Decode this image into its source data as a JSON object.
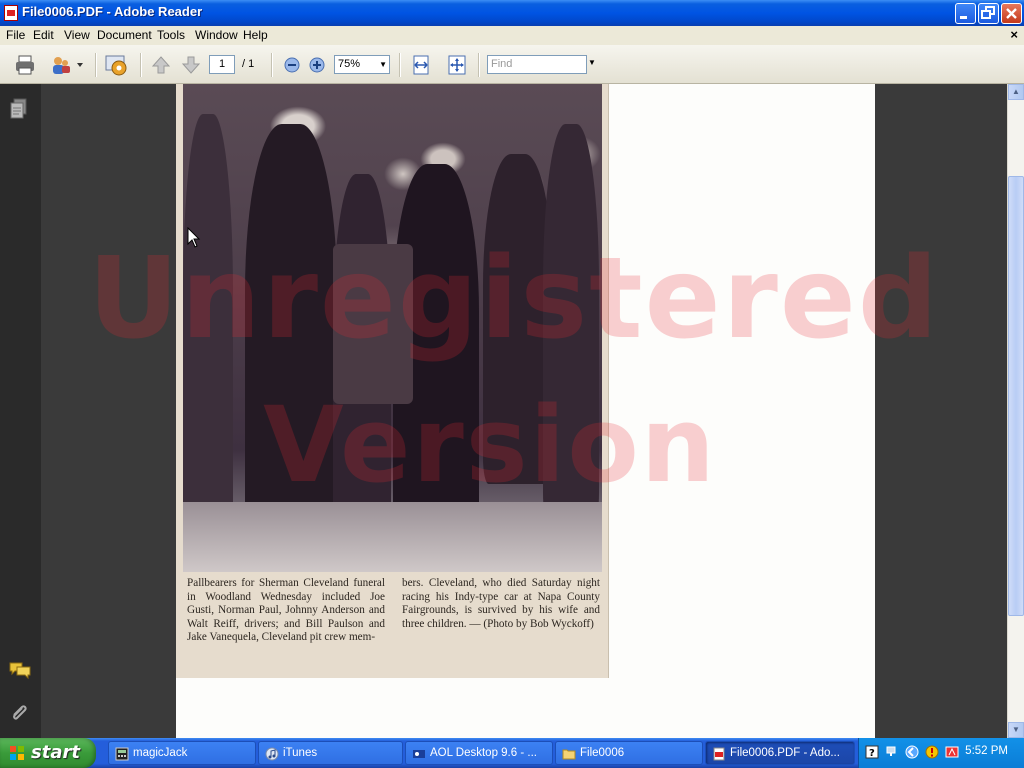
{
  "window": {
    "title": "File0006.PDF - Adobe Reader"
  },
  "menubar": {
    "items": [
      "File",
      "Edit",
      "View",
      "Document",
      "Tools",
      "Window",
      "Help"
    ],
    "close_glyph": "×"
  },
  "toolbar": {
    "current_page": "1",
    "total_pages": "/ 1",
    "zoom": "75%",
    "find_placeholder": "Find"
  },
  "document": {
    "caption_left": "Pallbearers for Sherman Cleveland funeral in Woodland Wednesday included Joe Gusti, Norman Paul, Johnny Anderson and Walt Reiff, drivers; and Bill Paulson and Jake Vanequela, Cleveland pit crew mem-",
    "caption_right": "bers. Cleveland, who died Saturday night racing his Indy-type car at Napa County Fairgrounds, is survived by his wife and three children. — (Photo by Bob Wyckoff)",
    "watermark_line1": "Unregistered",
    "watermark_line2": "Version"
  },
  "taskbar": {
    "start_label": "start",
    "tasks": [
      {
        "label": "magicJack",
        "icon": "calculator-icon",
        "active": false
      },
      {
        "label": "iTunes",
        "icon": "itunes-icon",
        "active": false
      },
      {
        "label": "AOL Desktop 9.6 - ...",
        "icon": "aol-icon",
        "active": false
      },
      {
        "label": "File0006",
        "icon": "folder-icon",
        "active": false
      },
      {
        "label": "File0006.PDF - Ado...",
        "icon": "pdf-icon",
        "active": true
      }
    ],
    "clock": "5:52 PM"
  },
  "colors": {
    "titlebar": "#0054e3",
    "taskbar": "#245edb",
    "start": "#3a9b3a",
    "watermark": "#e62832"
  }
}
